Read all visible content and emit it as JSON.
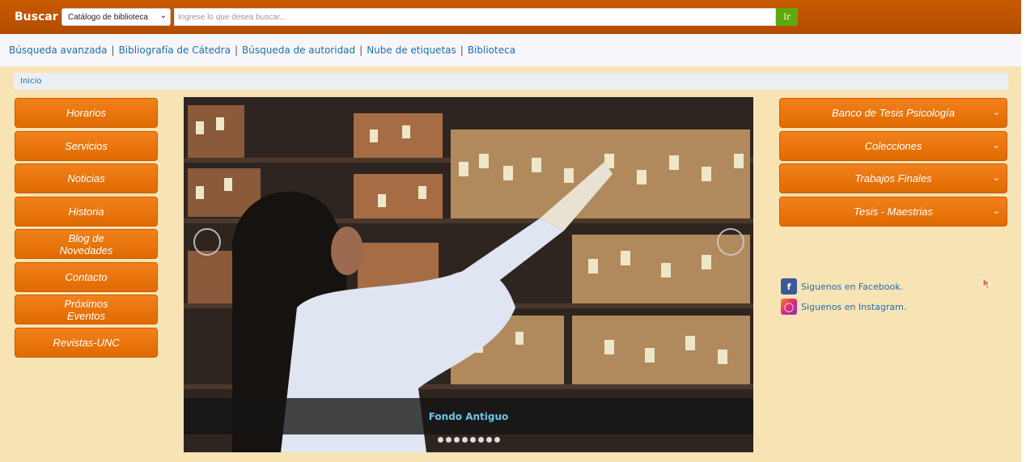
{
  "search_bar": {
    "label": "Buscar",
    "catalog_select": "Catálogo de biblioteca",
    "placeholder": "Ingrese lo que desea buscar...",
    "go_label": "Ir"
  },
  "nav_links": [
    "Búsqueda avanzada",
    "Bibliografía de Cátedra",
    "Búsqueda de autoridad",
    "Nube de etiquetas",
    "Biblioteca"
  ],
  "breadcrumb": "Inicio",
  "left_menu": [
    "Horarios",
    "Servicios",
    "Noticias",
    "Historia",
    "Blog de\nNovedades",
    "Contacto",
    "Próximos\nEventos",
    "Revistas-UNC"
  ],
  "right_menu": [
    "Banco de Tesis Psicología",
    "Colecciones",
    "Trabajos Finales",
    "Tesis - Maestrias"
  ],
  "carousel": {
    "caption": "Fondo Antiguo",
    "slide_count": 8
  },
  "social": {
    "facebook": "Siguenos en Facebook.",
    "instagram": "Siguenos en Instagram."
  },
  "colors": {
    "topbar": "#c85a00",
    "button_orange": "#f2811c",
    "beige": "#f8e3b5",
    "link_blue": "#1b6fb0",
    "go_green": "#5fa80e"
  }
}
